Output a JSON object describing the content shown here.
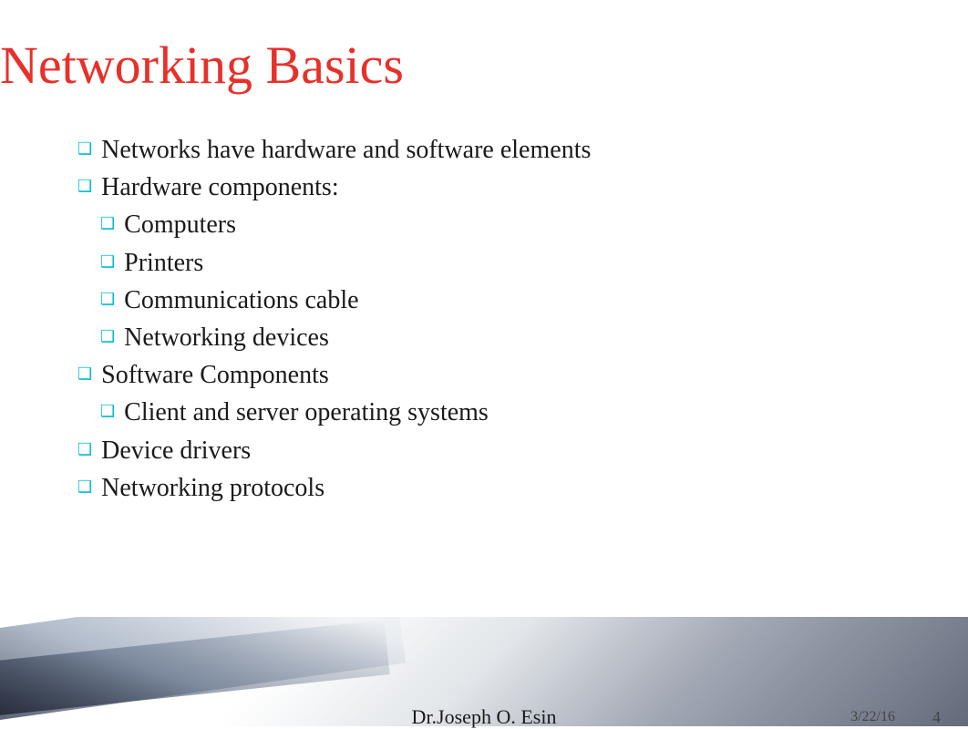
{
  "slide": {
    "title": "Networking Basics",
    "bullet_icon": "❑",
    "items": [
      {
        "text": "Networks have hardware and software elements",
        "indent": 1
      },
      {
        "text": "Hardware components:",
        "indent": 1
      },
      {
        "text": "Computers",
        "indent": 2
      },
      {
        "text": "Printers",
        "indent": 2
      },
      {
        "text": "Communications cable",
        "indent": 2
      },
      {
        "text": "Networking devices",
        "indent": 2
      },
      {
        "text": "Software Components",
        "indent": 1
      },
      {
        "text": "Client and server operating systems",
        "indent": 2
      },
      {
        "text": "Device drivers",
        "indent": 1
      },
      {
        "text": "Networking protocols",
        "indent": 1
      }
    ],
    "footer": {
      "author": "Dr.Joseph O. Esin",
      "date": "3/22/16",
      "page": "4"
    }
  }
}
